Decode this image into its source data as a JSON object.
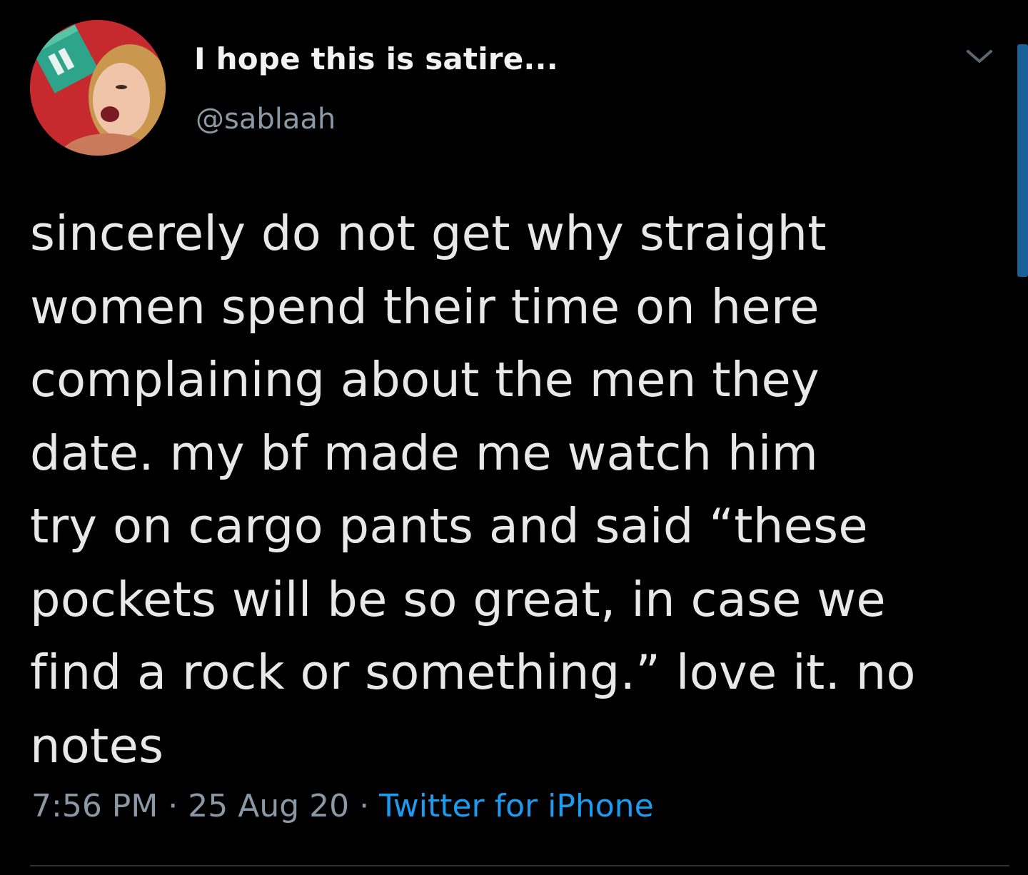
{
  "tweet": {
    "display_name": "I hope this is satire...",
    "handle": "@sablaah",
    "avatar_icon": "profile-photo",
    "body_lines": [
      "sincerely do not get why straight",
      "women spend their time on here",
      "complaining about the men they",
      "date. my bf made me watch him",
      "try on cargo pants and said “these",
      "pockets will be so great, in case we",
      "find a rock or something.” love it. no",
      "notes"
    ],
    "time": "7:56 PM",
    "date": "25 Aug 20",
    "separator": "·",
    "source": "Twitter for iPhone"
  },
  "colors": {
    "background": "#000000",
    "text": "#e8e8e8",
    "secondary": "#8b98a5",
    "link": "#1d9bf0",
    "scrollbar": "#1b5f98"
  },
  "icons": {
    "menu": "chevron-down-icon"
  }
}
